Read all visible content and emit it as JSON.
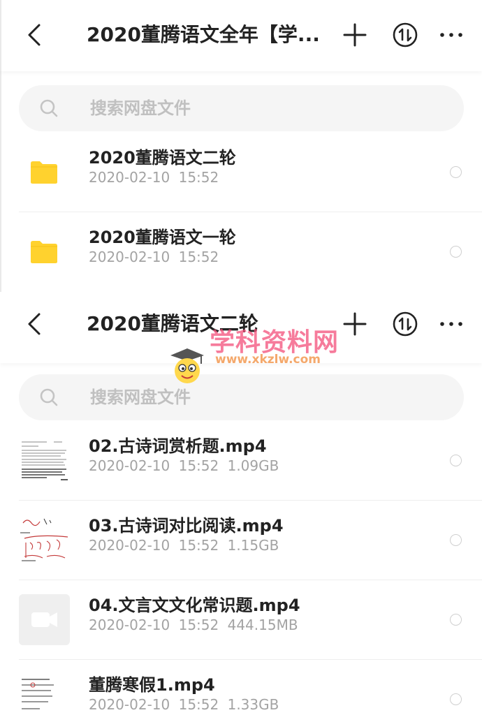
{
  "top_panel": {
    "title": "2020董腾语文全年【学...",
    "search_placeholder": "搜索网盘文件",
    "items": [
      {
        "name": "2020董腾语文二轮",
        "date": "2020-02-10",
        "time": "15:52",
        "type": "folder"
      },
      {
        "name": "2020董腾语文一轮",
        "date": "2020-02-10",
        "time": "15:52",
        "type": "folder"
      }
    ]
  },
  "bottom_panel": {
    "title": "2020董腾语文二轮",
    "search_placeholder": "搜索网盘文件",
    "items": [
      {
        "name": "02.古诗词赏析题.mp4",
        "date": "2020-02-10",
        "time": "15:52",
        "size": "1.09GB",
        "thumb": "document"
      },
      {
        "name": "03.古诗词对比阅读.mp4",
        "date": "2020-02-10",
        "time": "15:52",
        "size": "1.15GB",
        "thumb": "handwriting"
      },
      {
        "name": "04.文言文文化常识题.mp4",
        "date": "2020-02-10",
        "time": "15:52",
        "size": "444.15MB",
        "thumb": "video"
      },
      {
        "name": "董腾寒假1.mp4",
        "date": "2020-02-10",
        "time": "15:52",
        "size": "1.33GB",
        "thumb": "document"
      }
    ]
  },
  "watermark": {
    "text": "学科资料网",
    "url": "www.xkzlw.com"
  },
  "icons": {
    "back": "back-arrow-icon",
    "add": "plus-icon",
    "sort": "sort-icon",
    "more": "more-icon",
    "search": "search-icon",
    "folder": "folder-icon"
  },
  "colors": {
    "folder": "#FFD22E",
    "watermark_text": "#f4507a",
    "watermark_url": "#f39a52"
  }
}
